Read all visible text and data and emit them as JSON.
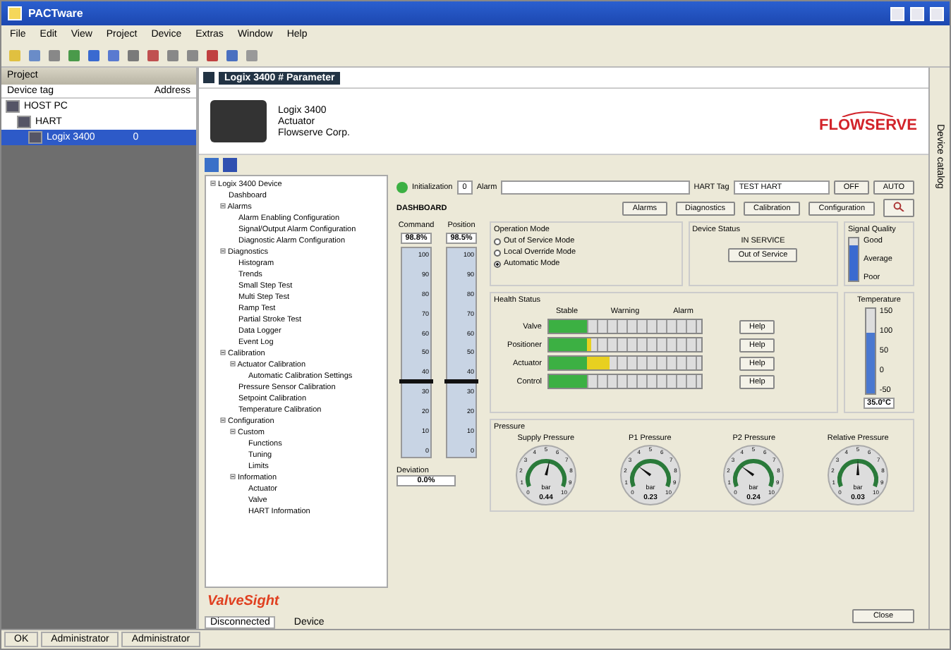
{
  "window": {
    "title": "PACTware"
  },
  "menu": [
    "File",
    "Edit",
    "View",
    "Project",
    "Device",
    "Extras",
    "Window",
    "Help"
  ],
  "project": {
    "title": "Project",
    "columns": [
      "Device tag",
      "Address"
    ],
    "tree": [
      {
        "label": "HOST PC",
        "selected": false,
        "children": [
          {
            "label": "HART",
            "selected": false,
            "children": [
              {
                "label": "Logix 3400",
                "address": "0",
                "selected": true
              }
            ]
          }
        ]
      }
    ]
  },
  "device_tab": {
    "title": "Logix 3400 # Parameter"
  },
  "device_info": {
    "lines": [
      "Logix 3400",
      "Actuator",
      "Flowserve Corp."
    ],
    "logo": "FLOWSERVE"
  },
  "nav_tree": [
    {
      "label": "Logix 3400 Device",
      "children": [
        {
          "label": "Dashboard"
        },
        {
          "label": "Alarms",
          "children": [
            {
              "label": "Alarm Enabling Configuration"
            },
            {
              "label": "Signal/Output Alarm Configuration"
            },
            {
              "label": "Diagnostic Alarm Configuration"
            }
          ]
        },
        {
          "label": "Diagnostics",
          "children": [
            {
              "label": "Histogram"
            },
            {
              "label": "Trends"
            },
            {
              "label": "Small Step Test"
            },
            {
              "label": "Multi Step Test"
            },
            {
              "label": "Ramp Test"
            },
            {
              "label": "Partial Stroke Test"
            },
            {
              "label": "Data Logger"
            },
            {
              "label": "Event Log"
            }
          ]
        },
        {
          "label": "Calibration",
          "children": [
            {
              "label": "Actuator Calibration",
              "children": [
                {
                  "label": "Automatic Calibration Settings"
                }
              ]
            },
            {
              "label": "Pressure Sensor Calibration"
            },
            {
              "label": "Setpoint Calibration"
            },
            {
              "label": "Temperature Calibration"
            }
          ]
        },
        {
          "label": "Configuration",
          "children": [
            {
              "label": "Custom",
              "children": [
                {
                  "label": "Functions"
                },
                {
                  "label": "Tuning"
                },
                {
                  "label": "Limits"
                }
              ]
            },
            {
              "label": "Information",
              "children": [
                {
                  "label": "Actuator"
                },
                {
                  "label": "Valve"
                },
                {
                  "label": "HART Information"
                }
              ]
            }
          ]
        }
      ]
    }
  ],
  "brand": "ValveSight",
  "bottom_tabs": [
    {
      "label": "Disconnected",
      "selected": true
    },
    {
      "label": "Device",
      "selected": false
    }
  ],
  "dashboard": {
    "status": {
      "label": "Initialization",
      "color": "#3cb043",
      "alarm_count": "0",
      "alarm_label": "Alarm",
      "hart_tag_label": "HART Tag",
      "hart_tag": "TEST HART",
      "mode_buttons": [
        "OFF",
        "AUTO"
      ]
    },
    "title": "DASHBOARD",
    "nav_buttons": [
      "Alarms",
      "Diagnostics",
      "Calibration",
      "Configuration"
    ],
    "scales": [
      {
        "label": "Command",
        "reading": "98.8%",
        "level": 0.35,
        "ticks": [
          "100",
          "90",
          "80",
          "70",
          "60",
          "50",
          "40",
          "30",
          "20",
          "10",
          "0"
        ]
      },
      {
        "label": "Position",
        "reading": "98.5%",
        "level": 0.35,
        "ticks": [
          "100",
          "90",
          "80",
          "70",
          "60",
          "50",
          "40",
          "30",
          "20",
          "10",
          "0"
        ]
      }
    ],
    "deviation": {
      "label": "Deviation",
      "reading": "0.0%"
    },
    "operation_mode": {
      "title": "Operation Mode",
      "options": [
        {
          "label": "Out of Service Mode",
          "selected": false
        },
        {
          "label": "Local Override Mode",
          "selected": false
        },
        {
          "label": "Automatic Mode",
          "selected": true
        }
      ]
    },
    "device_status": {
      "title": "Device Status",
      "value": "IN SERVICE",
      "button": "Out of Service"
    },
    "signal_quality": {
      "title": "Signal Quality",
      "labels": [
        "Good",
        "Average",
        "Poor"
      ],
      "level": 0.85
    },
    "health": {
      "title": "Health Status",
      "zones": [
        "Stable",
        "Warning",
        "Alarm"
      ],
      "rows": [
        {
          "label": "Valve",
          "level": 0.25,
          "help": "Help"
        },
        {
          "label": "Positioner",
          "level": 0.28,
          "help": "Help"
        },
        {
          "label": "Actuator",
          "level": 0.4,
          "help": "Help"
        },
        {
          "label": "Control",
          "level": 0.25,
          "help": "Help"
        }
      ]
    },
    "temperature": {
      "title": "Temperature",
      "ticks": [
        "150",
        "100",
        "50",
        "0",
        "-50"
      ],
      "level": 0.72,
      "reading": "35.0°C"
    },
    "pressure": {
      "title": "Pressure",
      "gauges": [
        {
          "title": "Supply Pressure",
          "unit": "bar",
          "reading": "0.44",
          "level": 0.55,
          "dial_labels": [
            "0",
            "1",
            "2",
            "3",
            "4",
            "5",
            "6",
            "7",
            "8",
            "9",
            "10"
          ]
        },
        {
          "title": "P1 Pressure",
          "unit": "bar",
          "reading": "0.23",
          "level": 0.3,
          "dial_labels": [
            "0",
            "1",
            "2",
            "3",
            "4",
            "5",
            "6",
            "7",
            "8",
            "9",
            "10"
          ]
        },
        {
          "title": "P2 Pressure",
          "unit": "bar",
          "reading": "0.24",
          "level": 0.3,
          "dial_labels": [
            "0",
            "1",
            "2",
            "3",
            "4",
            "5",
            "6",
            "7",
            "8",
            "9",
            "10"
          ]
        },
        {
          "title": "Relative Pressure",
          "unit": "bar",
          "reading": "0.03",
          "level": 0.5,
          "dial_labels": [
            "0",
            "1",
            "2",
            "3",
            "4",
            "5",
            "6",
            "7",
            "8",
            "9",
            "10"
          ]
        }
      ]
    },
    "close": "Close"
  },
  "side_strip": "Device catalog",
  "status_bar": [
    "OK",
    "Administrator",
    "Administrator"
  ]
}
